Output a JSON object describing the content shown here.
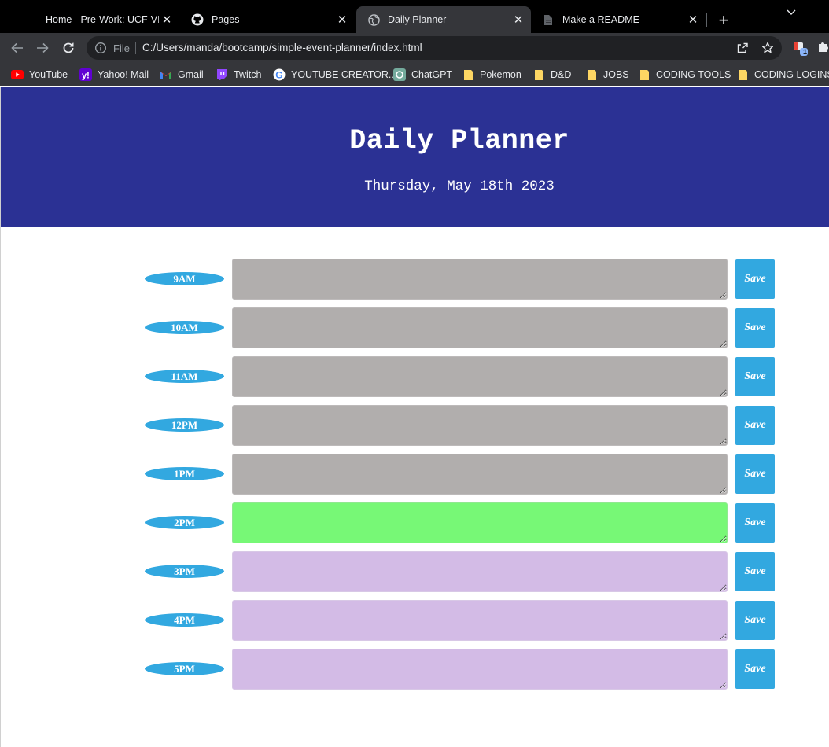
{
  "browser": {
    "tabs": [
      {
        "title": "Home - Pre-Work: UCF-VIRT-F",
        "icon": "canvas-icon"
      },
      {
        "title": "Pages",
        "icon": "github-icon"
      },
      {
        "title": "Daily Planner",
        "icon": "globe-icon",
        "active": true
      },
      {
        "title": "Make a README",
        "icon": "document-icon"
      }
    ],
    "address": {
      "scheme_label": "File",
      "url": "C:/Users/manda/bootcamp/simple-event-planner/index.html"
    },
    "extension_badge": "1",
    "bookmarks": [
      {
        "label": "YouTube",
        "icon": "youtube-icon"
      },
      {
        "label": "Yahoo! Mail",
        "icon": "yahoo-icon"
      },
      {
        "label": "Gmail",
        "icon": "gmail-icon"
      },
      {
        "label": "Twitch",
        "icon": "twitch-icon"
      },
      {
        "label": "YOUTUBE CREATOR...",
        "icon": "google-icon"
      },
      {
        "label": "ChatGPT",
        "icon": "chatgpt-icon"
      },
      {
        "label": "Pokemon",
        "icon": "folder-icon"
      },
      {
        "label": "D&D",
        "icon": "folder-icon"
      },
      {
        "label": "JOBS",
        "icon": "folder-icon"
      },
      {
        "label": "CODING TOOLS",
        "icon": "folder-icon"
      },
      {
        "label": "CODING LOGINS",
        "icon": "folder-icon"
      }
    ]
  },
  "header": {
    "title": "Daily Planner",
    "date": "Thursday, May 18th 2023"
  },
  "colors": {
    "header_bg": "#2b3194",
    "hour_badge": "#32a8e0",
    "save_button": "#32a8e0",
    "past": "#b1aead",
    "present": "#77f876",
    "future": "#d3bbe6"
  },
  "schedule": [
    {
      "hour": "9AM",
      "state": "past",
      "text": "",
      "save_label": "Save"
    },
    {
      "hour": "10AM",
      "state": "past",
      "text": "",
      "save_label": "Save"
    },
    {
      "hour": "11AM",
      "state": "past",
      "text": "",
      "save_label": "Save"
    },
    {
      "hour": "12PM",
      "state": "past",
      "text": "",
      "save_label": "Save"
    },
    {
      "hour": "1PM",
      "state": "past",
      "text": "",
      "save_label": "Save"
    },
    {
      "hour": "2PM",
      "state": "present",
      "text": "",
      "save_label": "Save"
    },
    {
      "hour": "3PM",
      "state": "future",
      "text": "",
      "save_label": "Save"
    },
    {
      "hour": "4PM",
      "state": "future",
      "text": "",
      "save_label": "Save"
    },
    {
      "hour": "5PM",
      "state": "future",
      "text": "",
      "save_label": "Save"
    }
  ]
}
